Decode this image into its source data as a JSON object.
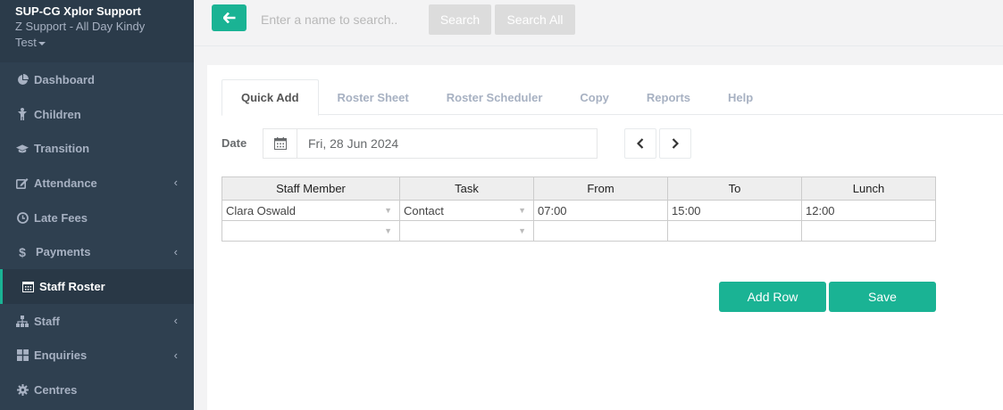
{
  "sidebar": {
    "org_name": "SUP-CG Xplor Support",
    "user_line1": "Z Support - All Day Kindy",
    "user_line2": "Test",
    "items": [
      {
        "label": "Dashboard",
        "icon": "pie-chart-icon",
        "arrow": false
      },
      {
        "label": "Children",
        "icon": "child-icon",
        "arrow": false
      },
      {
        "label": "Transition",
        "icon": "graduation-cap-icon",
        "arrow": false
      },
      {
        "label": "Attendance",
        "icon": "edit-icon",
        "arrow": true
      },
      {
        "label": "Late Fees",
        "icon": "clock-icon",
        "arrow": false
      },
      {
        "label": "Payments",
        "icon": "dollar-icon",
        "arrow": true
      },
      {
        "label": "Staff Roster",
        "icon": "calendar-icon",
        "arrow": false,
        "active": true
      },
      {
        "label": "Staff",
        "icon": "sitemap-icon",
        "arrow": true
      },
      {
        "label": "Enquiries",
        "icon": "grid-icon",
        "arrow": true
      },
      {
        "label": "Centres",
        "icon": "gear-icon",
        "arrow": false
      }
    ]
  },
  "topbar": {
    "search_placeholder": "Enter a name to search..",
    "search_label": "Search",
    "search_all_label": "Search All"
  },
  "tabs": [
    "Quick Add",
    "Roster Sheet",
    "Roster Scheduler",
    "Copy",
    "Reports",
    "Help"
  ],
  "date": {
    "label": "Date",
    "value": "Fri, 28 Jun 2024"
  },
  "grid": {
    "headers": [
      "Staff Member",
      "Task",
      "From",
      "To",
      "Lunch"
    ],
    "rows": [
      [
        "Clara Oswald",
        "Contact",
        "07:00",
        "15:00",
        "12:00"
      ],
      [
        "",
        "",
        "",
        "",
        ""
      ]
    ]
  },
  "actions": {
    "add_row": "Add Row",
    "save": "Save"
  },
  "colors": {
    "accent": "#1ab394",
    "sidebar": "#2f4050"
  }
}
